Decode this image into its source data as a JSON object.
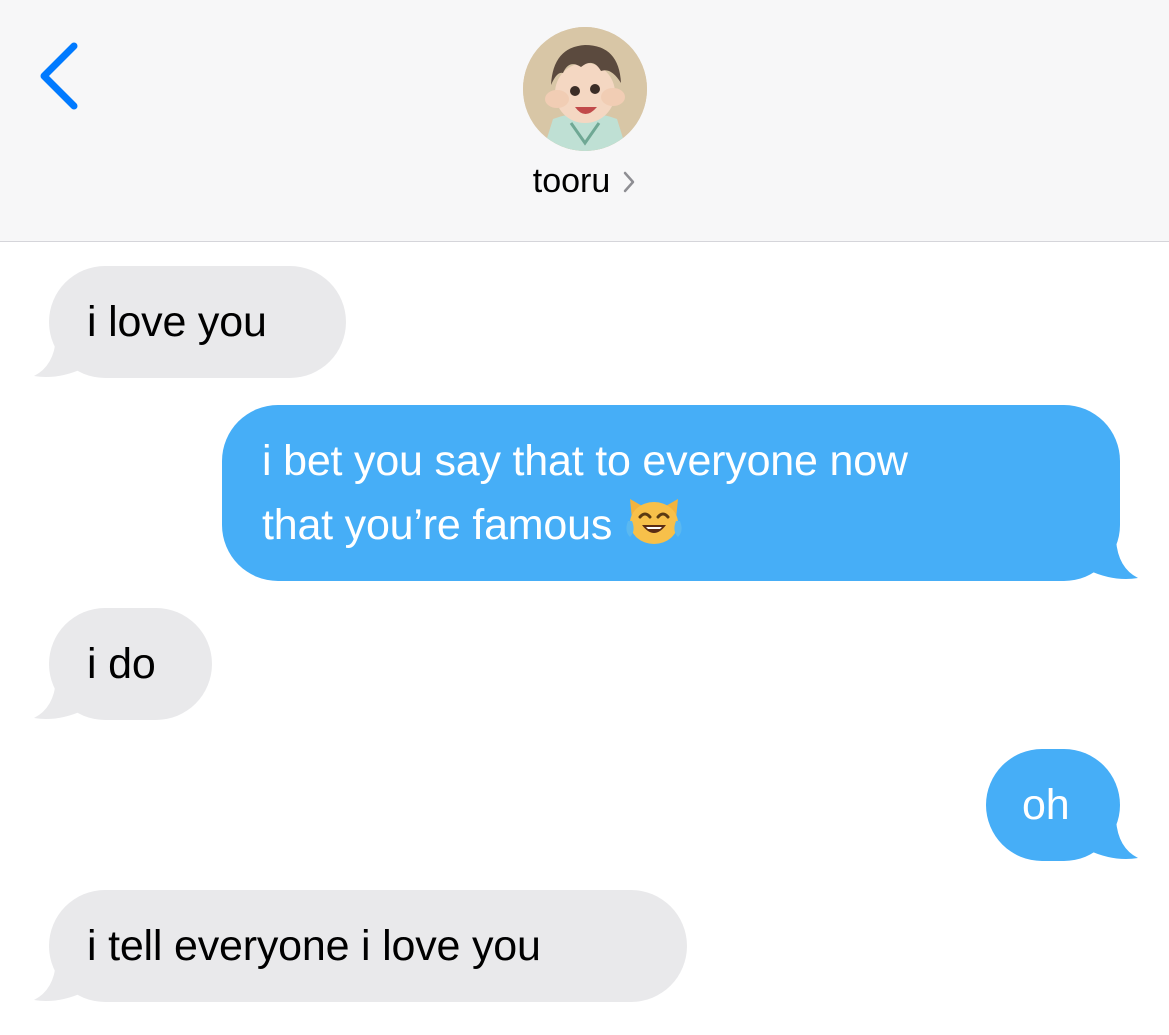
{
  "header": {
    "contact_name": "tooru"
  },
  "messages": [
    {
      "direction": "received",
      "text": "i love you"
    },
    {
      "direction": "sent",
      "text": "i bet you say that to everyone now",
      "text_line2": "that you’re famous"
    },
    {
      "direction": "received",
      "text": "i do"
    },
    {
      "direction": "sent",
      "text": "oh"
    },
    {
      "direction": "received",
      "text": "i tell everyone i love you"
    }
  ],
  "colors": {
    "accent": "#007aff",
    "sent_bubble": "#46aef7",
    "received_bubble": "#e9e9eb",
    "header_bg": "#f7f7f8"
  },
  "icons": {
    "back": "chevron-left-icon",
    "contact_chevron": "chevron-right-icon",
    "emoji": "cat-tears-of-joy-emoji"
  }
}
